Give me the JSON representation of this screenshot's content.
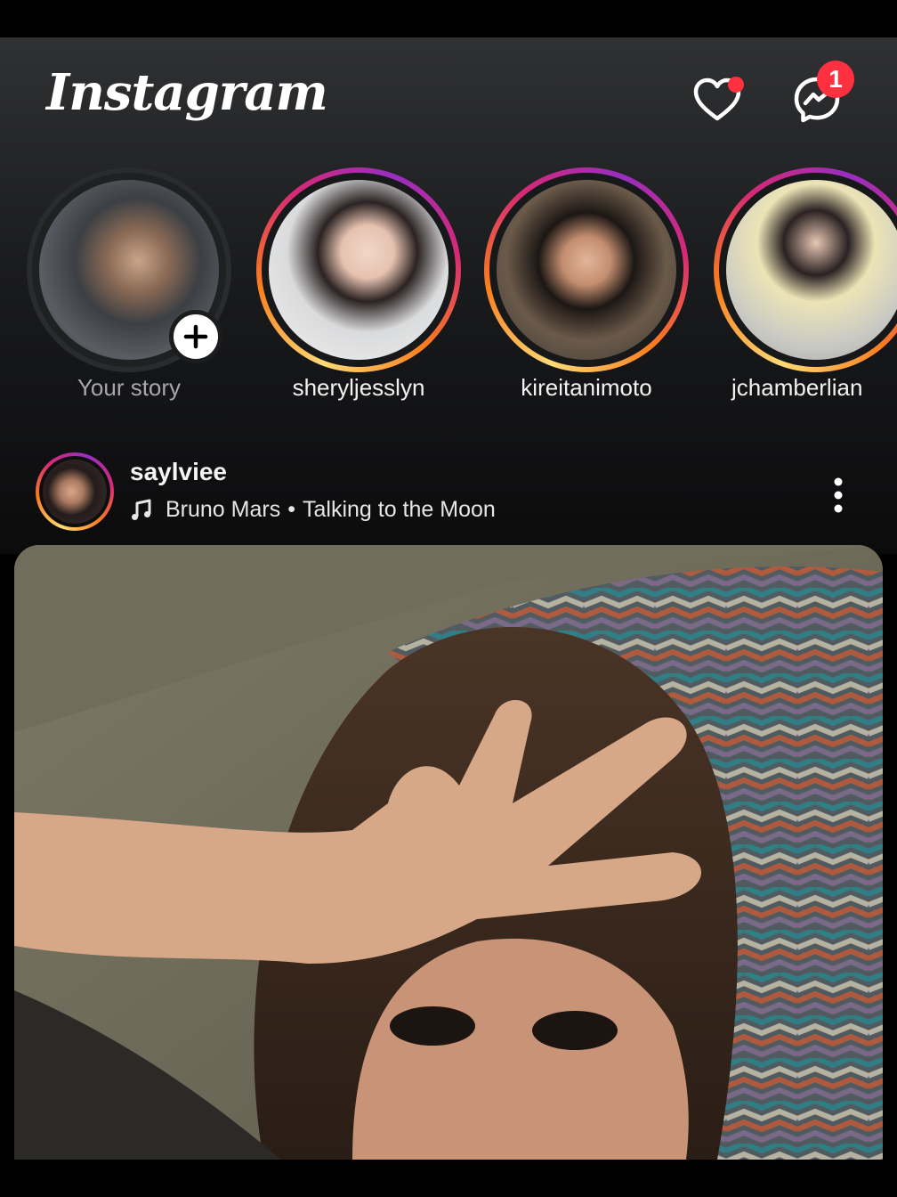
{
  "header": {
    "logo": "Instagram",
    "activity_icon": "heart-icon",
    "messages_icon": "messenger-icon",
    "messages_badge": "1"
  },
  "stories": [
    {
      "username": "Your story",
      "own": true
    },
    {
      "username": "sheryljesslyn",
      "own": false
    },
    {
      "username": "kireitanimoto",
      "own": false
    },
    {
      "username": "jchamberlian",
      "own": false
    }
  ],
  "post": {
    "username": "saylviee",
    "audio": {
      "artist": "Bruno Mars",
      "separator": "•",
      "song": "Talking to the Moon"
    },
    "more_icon": "more-vertical-icon"
  },
  "colors": {
    "badge": "#ff3040",
    "story_ring_start": "#feda75",
    "story_ring_mid": "#d62976",
    "story_ring_end": "#962fbf"
  }
}
